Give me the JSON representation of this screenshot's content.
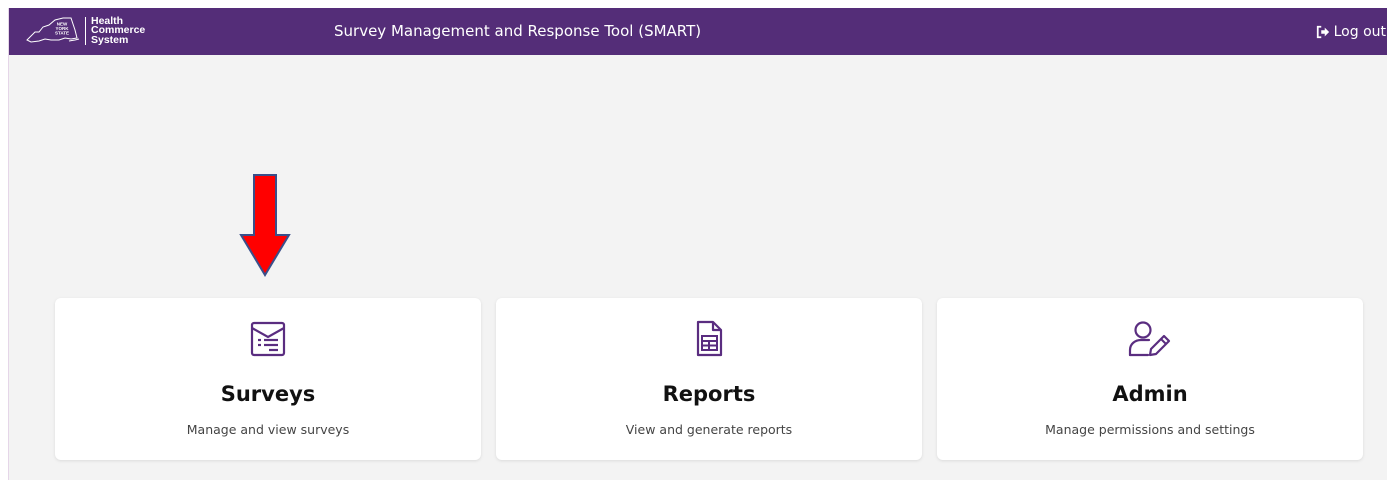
{
  "header": {
    "logo_text": "Health\nCommerce\nSystem",
    "app_title": "Survey Management and Response Tool (SMART)",
    "logout_label": "Log out"
  },
  "cards": [
    {
      "icon": "survey-icon",
      "title": "Surveys",
      "description": "Manage and view surveys"
    },
    {
      "icon": "report-icon",
      "title": "Reports",
      "description": "View and generate reports"
    },
    {
      "icon": "user-edit-icon",
      "title": "Admin",
      "description": "Manage permissions and settings"
    }
  ],
  "colors": {
    "header_bg": "#542d78",
    "accent": "#5a2d80",
    "page_bg": "#f3f3f3",
    "annotation_arrow": "#ff0000"
  }
}
